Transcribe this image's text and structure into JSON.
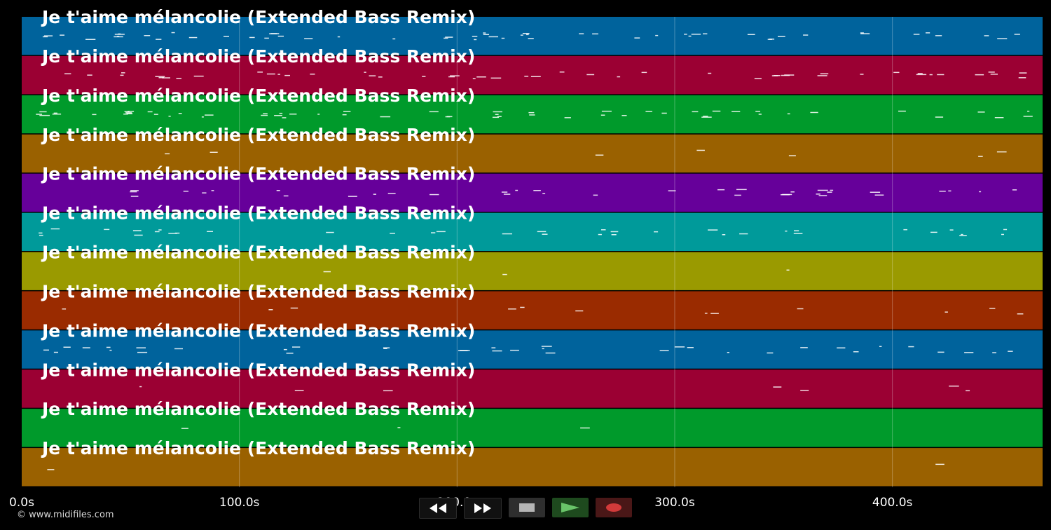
{
  "track_title": "Je t'aime mélancolie (Extended Bass Remix)",
  "tracks": [
    {
      "name": "Je t'aime mélancolie (Extended Bass Remix)",
      "color": "#00639c"
    },
    {
      "name": "Je t'aime mélancolie (Extended Bass Remix)",
      "color": "#9b0033"
    },
    {
      "name": "Je t'aime mélancolie (Extended Bass Remix)",
      "color": "#009a2b"
    },
    {
      "name": "Je t'aime mélancolie (Extended Bass Remix)",
      "color": "#9a6100"
    },
    {
      "name": "Je t'aime mélancolie (Extended Bass Remix)",
      "color": "#66009a"
    },
    {
      "name": "Je t'aime mélancolie (Extended Bass Remix)",
      "color": "#009a9a"
    },
    {
      "name": "Je t'aime mélancolie (Extended Bass Remix)",
      "color": "#9a9a00"
    },
    {
      "name": "Je t'aime mélancolie (Extended Bass Remix)",
      "color": "#9a2b00"
    },
    {
      "name": "Je t'aime mélancolie (Extended Bass Remix)",
      "color": "#00639c"
    },
    {
      "name": "Je t'aime mélancolie (Extended Bass Remix)",
      "color": "#9b0033"
    },
    {
      "name": "Je t'aime mélancolie (Extended Bass Remix)",
      "color": "#009a2b"
    },
    {
      "name": "Je t'aime mélancolie (Extended Bass Remix)",
      "color": "#9a6100"
    }
  ],
  "time_axis": {
    "unit": "s",
    "min": 0,
    "max": 469,
    "ticks": [
      "0.0s",
      "100.0s",
      "200.0s",
      "300.0s",
      "400.0s"
    ],
    "tick_values": [
      0,
      100,
      200,
      300,
      400
    ]
  },
  "controls": {
    "rewind_icon": "rewind-icon",
    "forward_icon": "fast-forward-icon",
    "stop_icon": "stop-icon",
    "play_icon": "play-icon",
    "record_icon": "record-icon"
  },
  "copyright": "© www.midifiles.com"
}
